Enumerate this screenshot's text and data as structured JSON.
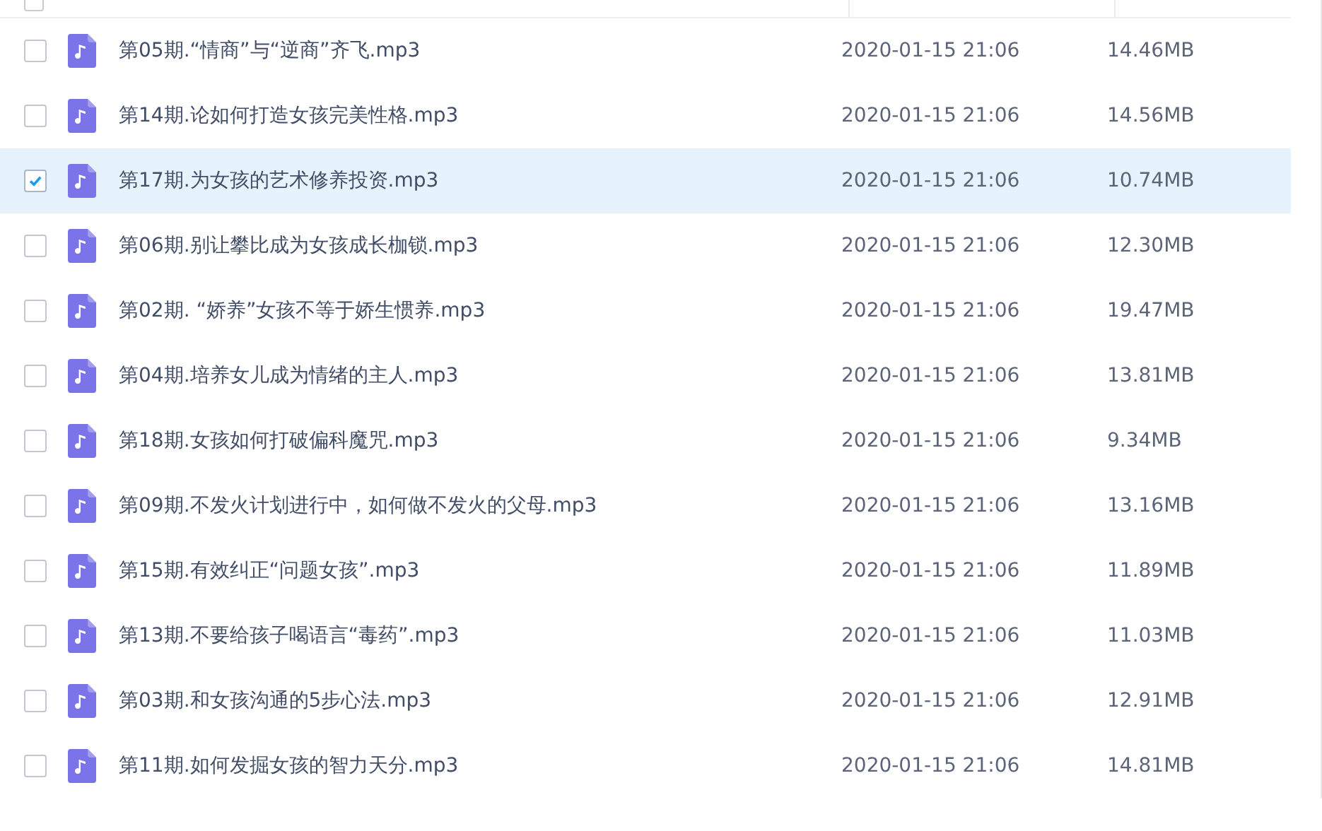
{
  "header": {
    "checked": false
  },
  "files": [
    {
      "name": "第05期.“情商”与“逆商”齐飞.mp3",
      "modified": "2020-01-15 21:06",
      "size": "14.46MB",
      "selected": false
    },
    {
      "name": "第14期.论如何打造女孩完美性格.mp3",
      "modified": "2020-01-15 21:06",
      "size": "14.56MB",
      "selected": false
    },
    {
      "name": "第17期.为女孩的艺术修养投资.mp3",
      "modified": "2020-01-15 21:06",
      "size": "10.74MB",
      "selected": true
    },
    {
      "name": "第06期.别让攀比成为女孩成长枷锁.mp3",
      "modified": "2020-01-15 21:06",
      "size": "12.30MB",
      "selected": false
    },
    {
      "name": "第02期. “娇养”女孩不等于娇生惯养.mp3",
      "modified": "2020-01-15 21:06",
      "size": "19.47MB",
      "selected": false
    },
    {
      "name": "第04期.培养女儿成为情绪的主人.mp3",
      "modified": "2020-01-15 21:06",
      "size": "13.81MB",
      "selected": false
    },
    {
      "name": "第18期.女孩如何打破偏科魔咒.mp3",
      "modified": "2020-01-15 21:06",
      "size": "9.34MB",
      "selected": false
    },
    {
      "name": "第09期.不发火计划进行中，如何做不发火的父母.mp3",
      "modified": "2020-01-15 21:06",
      "size": "13.16MB",
      "selected": false
    },
    {
      "name": "第15期.有效纠正“问题女孩”.mp3",
      "modified": "2020-01-15 21:06",
      "size": "11.89MB",
      "selected": false
    },
    {
      "name": "第13期.不要给孩子喝语言“毒药”.mp3",
      "modified": "2020-01-15 21:06",
      "size": "11.03MB",
      "selected": false
    },
    {
      "name": "第03期.和女孩沟通的5步心法.mp3",
      "modified": "2020-01-15 21:06",
      "size": "12.91MB",
      "selected": false
    },
    {
      "name": "第11期.如何发掘女孩的智力天分.mp3",
      "modified": "2020-01-15 21:06",
      "size": "14.81MB",
      "selected": false
    }
  ]
}
